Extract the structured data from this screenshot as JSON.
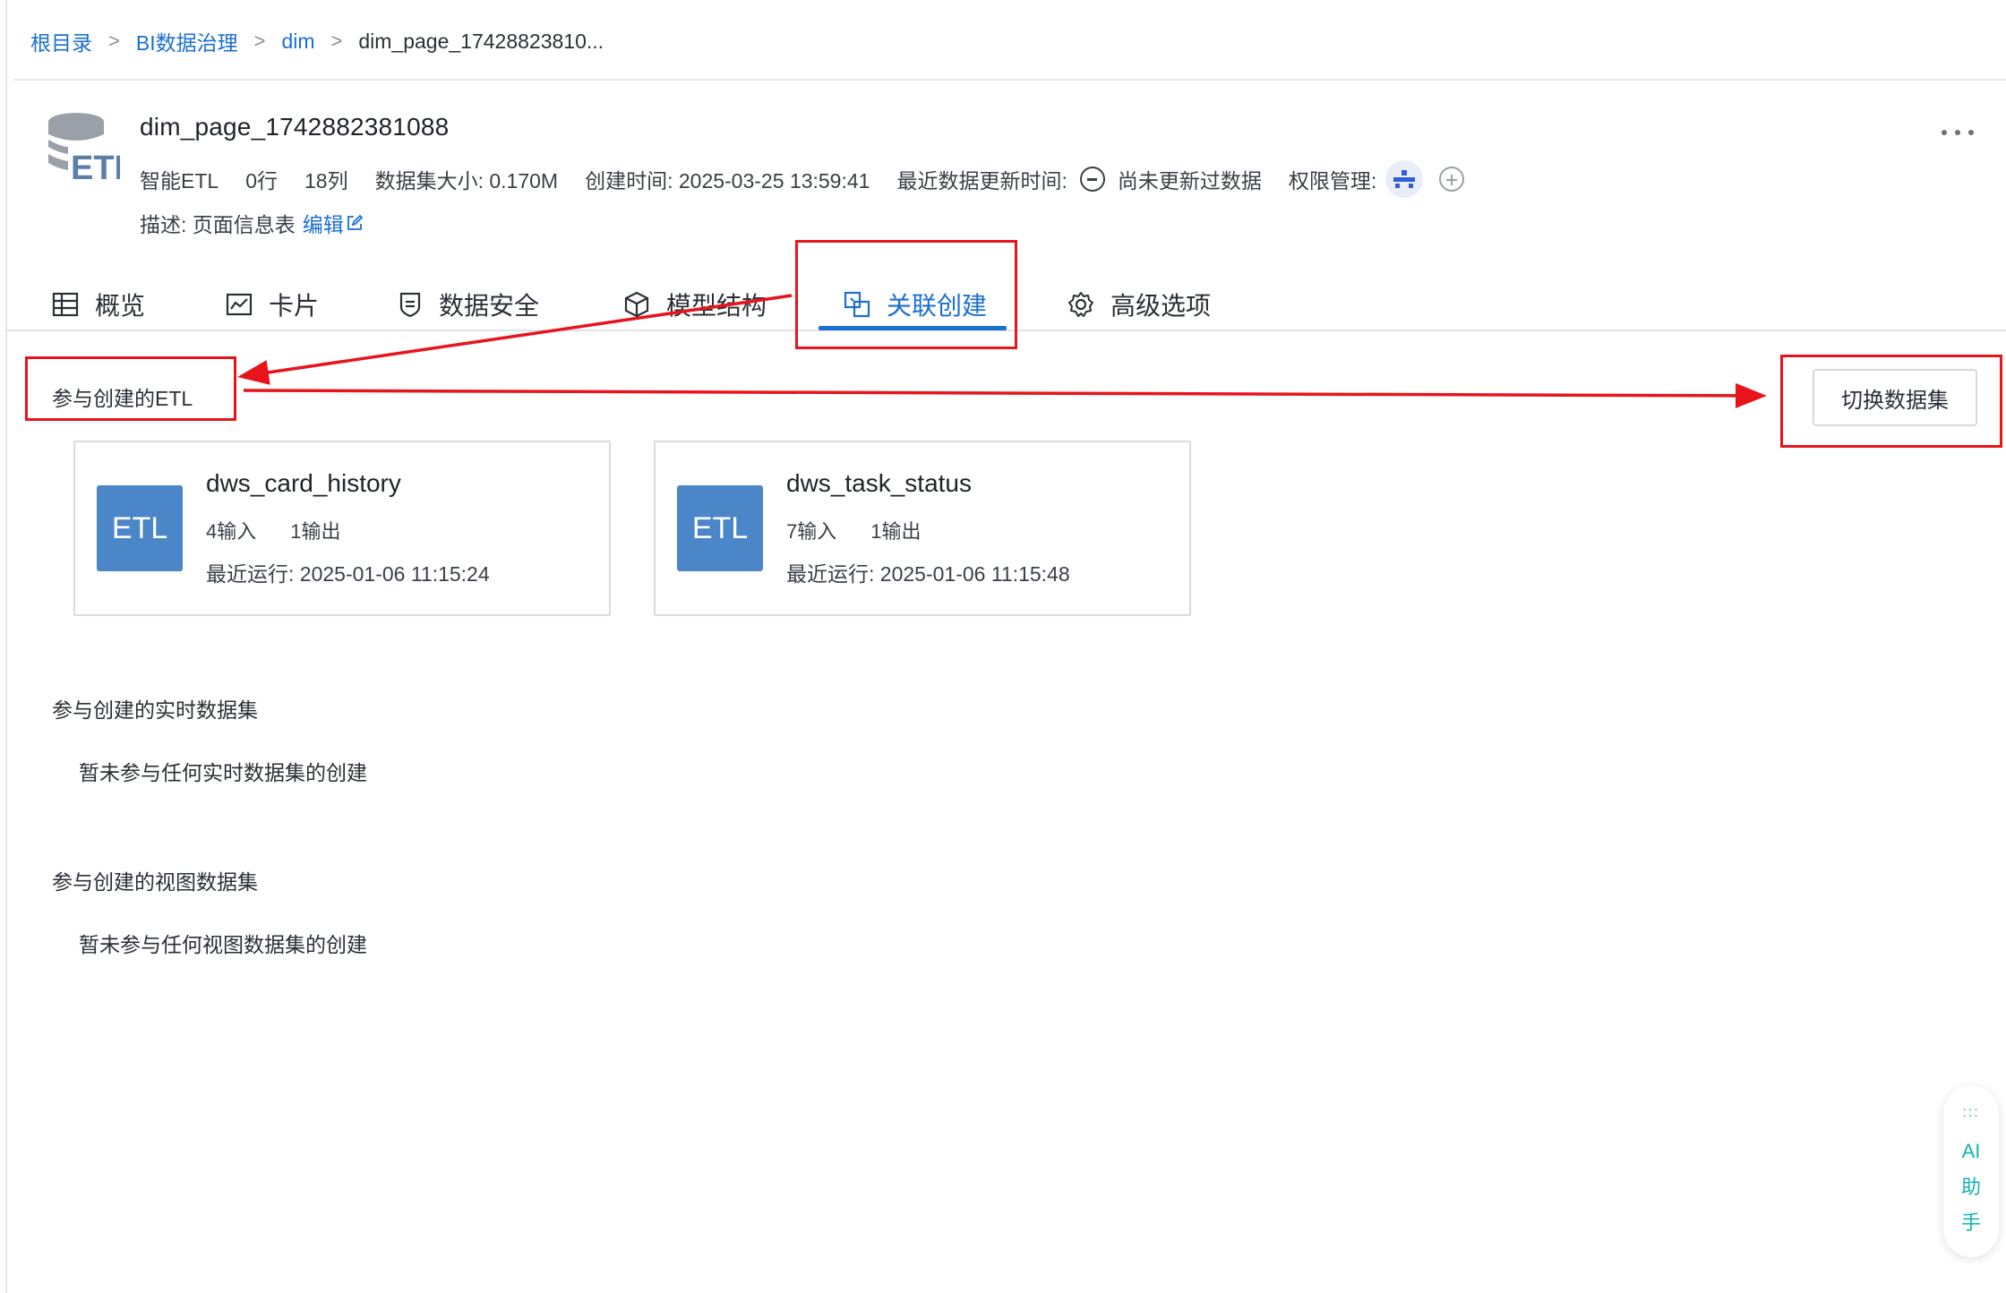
{
  "breadcrumb": {
    "items": [
      "根目录",
      "BI数据治理",
      "dim"
    ],
    "separator": ">",
    "current": "dim_page_17428823810..."
  },
  "dataset": {
    "logo_text": "ETL",
    "name": "dim_page_1742882381088",
    "type": "智能ETL",
    "rows": "0行",
    "cols": "18列",
    "size_label": "数据集大小: 0.170M",
    "created_label": "创建时间: 2025-03-25 13:59:41",
    "updated_label": "最近数据更新时间:",
    "updated_value": "尚未更新过数据",
    "permission_label": "权限管理:",
    "desc_label": "描述: 页面信息表",
    "edit_label": "编辑"
  },
  "tabs": {
    "overview": "概览",
    "card": "卡片",
    "security": "数据安全",
    "model": "模型结构",
    "relation": "关联创建",
    "advanced": "高级选项"
  },
  "sections": {
    "etl_title": "参与创建的ETL",
    "switch_button": "切换数据集",
    "realtime_title": "参与创建的实时数据集",
    "realtime_empty": "暂未参与任何实时数据集的创建",
    "view_title": "参与创建的视图数据集",
    "view_empty": "暂未参与任何视图数据集的创建"
  },
  "etl_cards": [
    {
      "badge": "ETL",
      "name": "dws_card_history",
      "inputs": "4输入",
      "outputs": "1输出",
      "last_run": "最近运行: 2025-01-06 11:15:24"
    },
    {
      "badge": "ETL",
      "name": "dws_task_status",
      "inputs": "7输入",
      "outputs": "1输出",
      "last_run": "最近运行: 2025-01-06 11:15:48"
    }
  ],
  "ai_helper": {
    "dots": ":::",
    "label": [
      "AI",
      "助",
      "手"
    ]
  },
  "colors": {
    "accent": "#1b6fd1",
    "etl_badge": "#4a86c8",
    "annotation": "#e8141b",
    "ai": "#13b5b1"
  }
}
